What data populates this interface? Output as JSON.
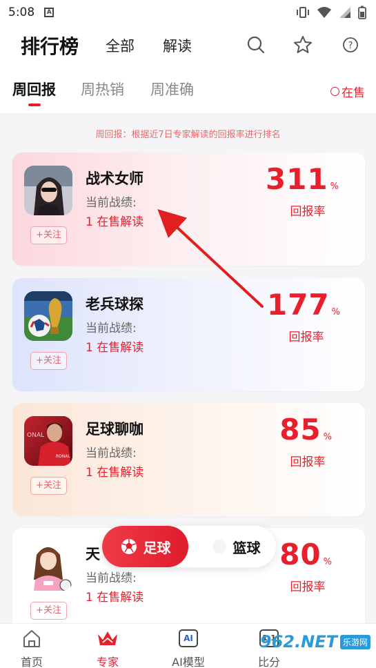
{
  "statusbar": {
    "time": "5:08",
    "notif_icon": "A"
  },
  "header": {
    "title": "排行榜",
    "nav_all": "全部",
    "nav_interpret": "解读"
  },
  "tabs": [
    {
      "label": "周回报"
    },
    {
      "label": "周热销"
    },
    {
      "label": "周准确"
    }
  ],
  "on_sale_label": "在售",
  "description": "周回报：根据近7日专家解读的回报率进行排名",
  "experts": [
    {
      "name": "战术女师",
      "record_label": "当前战绩:",
      "sale_text": "1 在售解读",
      "rate": "311",
      "pct": "%",
      "rate_label": "回报率",
      "follow": "+关注"
    },
    {
      "name": "老兵球探",
      "record_label": "当前战绩:",
      "sale_text": "1 在售解读",
      "rate": "177",
      "pct": "%",
      "rate_label": "回报率",
      "follow": "+关注"
    },
    {
      "name": "足球聊咖",
      "record_label": "当前战绩:",
      "sale_text": "1 在售解读",
      "rate": "85",
      "pct": "%",
      "rate_label": "回报率",
      "follow": "+关注"
    },
    {
      "name": "天",
      "record_label": "当前战绩:",
      "sale_text": "1 在售解读",
      "rate": "80",
      "pct": "%",
      "rate_label": "回报率",
      "follow": "+关注"
    }
  ],
  "sport_toggle": {
    "active": "足球",
    "inactive": "篮球"
  },
  "bottom_nav": [
    {
      "label": "首页",
      "icon": "home-icon"
    },
    {
      "label": "专家",
      "icon": "crown-icon"
    },
    {
      "label": "AI模型",
      "icon": "ai-icon",
      "badge": "AI"
    },
    {
      "label": "比分",
      "icon": "score-icon",
      "badge": "1:1"
    }
  ],
  "watermark": {
    "brand": "962.NET",
    "sub": "乐游网"
  },
  "colors": {
    "accent": "#e8202e",
    "gold_crown": "#e8202e"
  }
}
